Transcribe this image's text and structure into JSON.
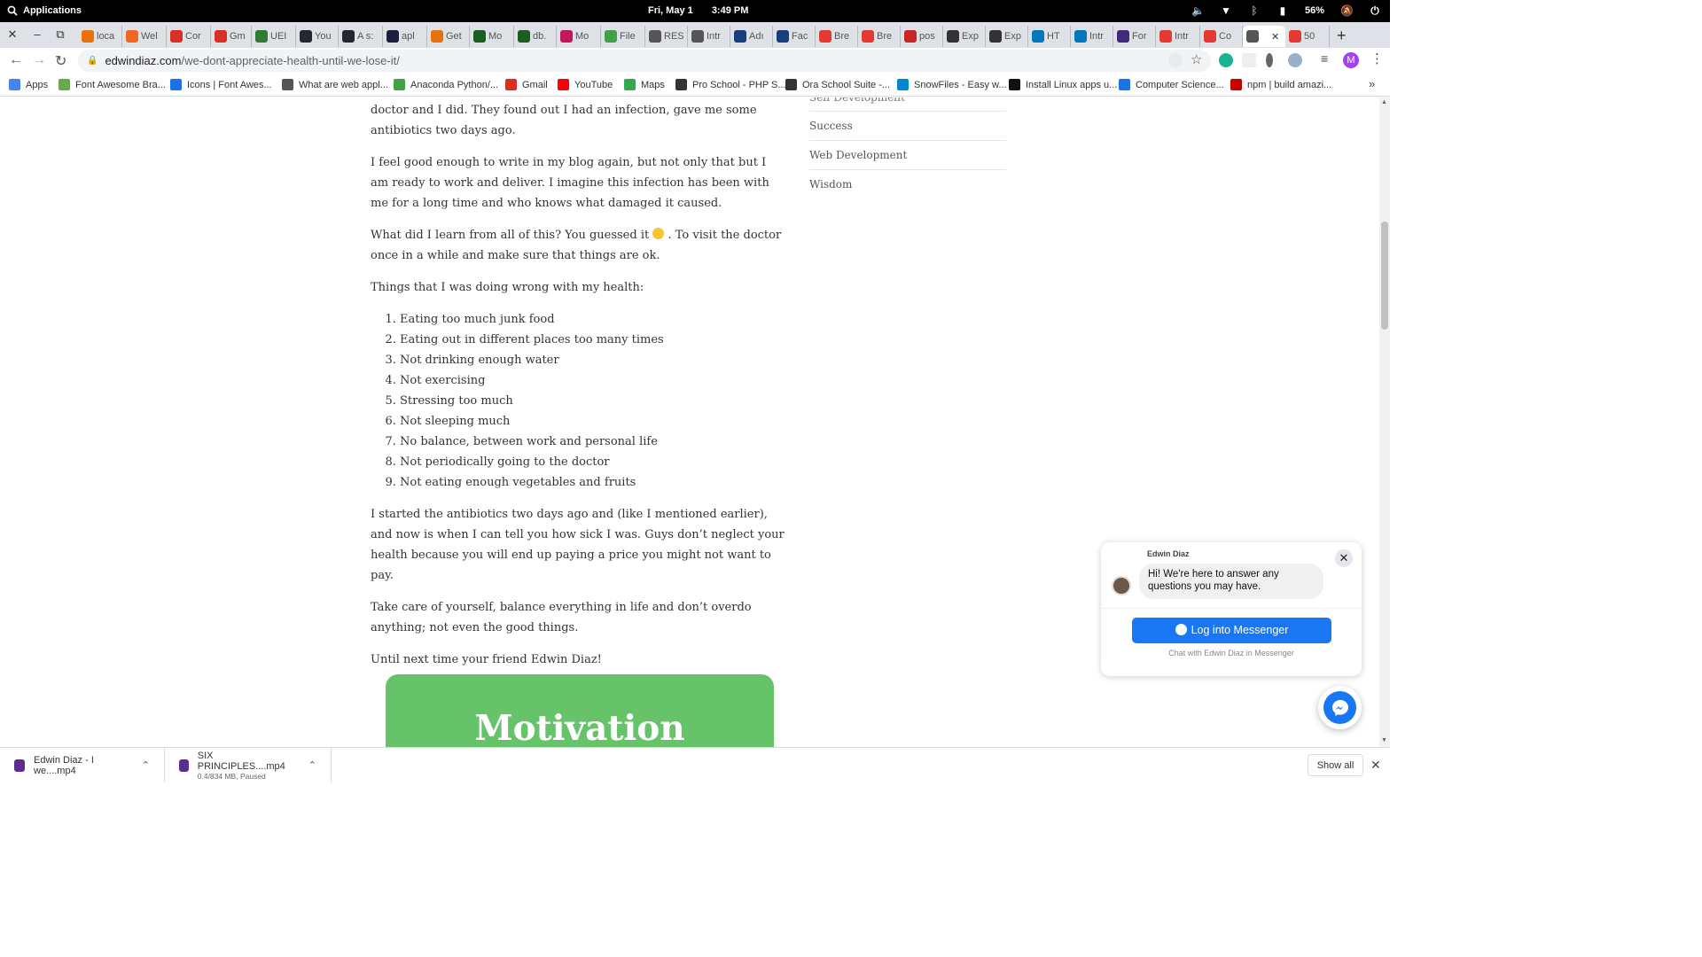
{
  "os": {
    "apps_label": "Applications",
    "date": "Fri, May 1",
    "time": "3:49 PM",
    "battery": "56%"
  },
  "tabs": [
    {
      "label": "loca",
      "color": "#e8710a"
    },
    {
      "label": "Wel",
      "color": "#f26522"
    },
    {
      "label": "Cor",
      "color": "#d93025"
    },
    {
      "label": "Gm",
      "color": "#d93025"
    },
    {
      "label": "UEI",
      "color": "#2e7d32"
    },
    {
      "label": "You",
      "color": "#24292e"
    },
    {
      "label": "A s:",
      "color": "#24292e"
    },
    {
      "label": "apl",
      "color": "#1b1f3b"
    },
    {
      "label": "Get",
      "color": "#e8710a"
    },
    {
      "label": "Mo",
      "color": "#1b5e20"
    },
    {
      "label": "db.",
      "color": "#1b5e20"
    },
    {
      "label": "Mo",
      "color": "#c2185b"
    },
    {
      "label": "File",
      "color": "#43a047"
    },
    {
      "label": "RES",
      "color": "#555555"
    },
    {
      "label": "Intr",
      "color": "#555555"
    },
    {
      "label": "Adı",
      "color": "#1a3d7c"
    },
    {
      "label": "Fac",
      "color": "#1a3d7c"
    },
    {
      "label": "Bre",
      "color": "#e53935"
    },
    {
      "label": "Bre",
      "color": "#e53935"
    },
    {
      "label": "pos",
      "color": "#c62828"
    },
    {
      "label": "Exp",
      "color": "#333333"
    },
    {
      "label": "Exp",
      "color": "#333333"
    },
    {
      "label": "HT",
      "color": "#0277bd"
    },
    {
      "label": "Intr",
      "color": "#0277bd"
    },
    {
      "label": "For",
      "color": "#3f2b7a"
    },
    {
      "label": "Intr",
      "color": "#e53935"
    },
    {
      "label": "Co",
      "color": "#e53935"
    },
    {
      "label": "",
      "color": "#555555"
    },
    {
      "label": "50",
      "color": "#e53935"
    }
  ],
  "address": {
    "host": "edwindiaz.com",
    "path": "/we-dont-appreciate-health-until-we-lose-it/"
  },
  "profile_initial": "M",
  "bookmarks": [
    {
      "label": "Apps",
      "color": "#4285f4"
    },
    {
      "label": "Font Awesome Bra...",
      "color": "#6aa84f"
    },
    {
      "label": "Icons | Font Awes...",
      "color": "#1a73e8"
    },
    {
      "label": "What are web appl...",
      "color": "#555555"
    },
    {
      "label": "Anaconda Python/...",
      "color": "#43a047"
    },
    {
      "label": "Gmail",
      "color": "#d93025"
    },
    {
      "label": "YouTube",
      "color": "#ff0000"
    },
    {
      "label": "Maps",
      "color": "#34a853"
    },
    {
      "label": "Pro School - PHP S...",
      "color": "#333333"
    },
    {
      "label": "Ora School Suite -...",
      "color": "#333333"
    },
    {
      "label": "SnowFiles - Easy w...",
      "color": "#0288d1"
    },
    {
      "label": "Install Linux apps u...",
      "color": "#111111"
    },
    {
      "label": "Computer Science...",
      "color": "#1a73e8"
    },
    {
      "label": "npm | build amazi...",
      "color": "#cb0000"
    }
  ],
  "article": {
    "p1": "doctor and I did. They found out I had an infection, gave me some antibiotics two days ago.",
    "p2": "I feel good enough to write in my blog again, but not only that but I am ready to work and deliver. I imagine this infection has been with me for a long time and who knows what damaged it caused.",
    "p3_a": "What did I learn from all of this? You guessed it",
    "p3_b": ". To visit the doctor once in a while and make sure that things are ok.",
    "p4": "Things that I was doing wrong with my health:",
    "list": [
      "Eating too much junk food",
      "Eating out in different places too many times",
      "Not drinking enough water",
      "Not exercising",
      "Stressing too much",
      "Not sleeping much",
      "No balance, between work and personal life",
      "Not periodically going to the doctor",
      "Not eating enough vegetables and fruits"
    ],
    "p5": "I started the antibiotics two days ago and (like I mentioned earlier), and now is when I can tell you how sick I was. Guys don’t neglect your health because you will end up paying a price you might not want to pay.",
    "p6": "Take care of yourself, balance everything in life and don’t overdo anything; not even the good things.",
    "p7": "Until next time your friend Edwin Diaz!",
    "banner": "Motivation"
  },
  "sidebar": {
    "categories": [
      "Self Development",
      "Success",
      "Web Development",
      "Wisdom"
    ]
  },
  "chat": {
    "name": "Edwin Diaz",
    "message": "Hi! We're here to answer any questions you may have.",
    "login_button": "Log into Messenger",
    "footer": "Chat with Edwin Diaz in Messenger"
  },
  "downloads": [
    {
      "name": "Edwin Diaz - I we....mp4",
      "status": ""
    },
    {
      "name": "SIX PRINCIPLES....mp4",
      "status": "0.4/834 MB, Paused"
    }
  ],
  "show_all": "Show all",
  "colors": {
    "messenger": "#1877f2",
    "banner": "#67c36a"
  }
}
